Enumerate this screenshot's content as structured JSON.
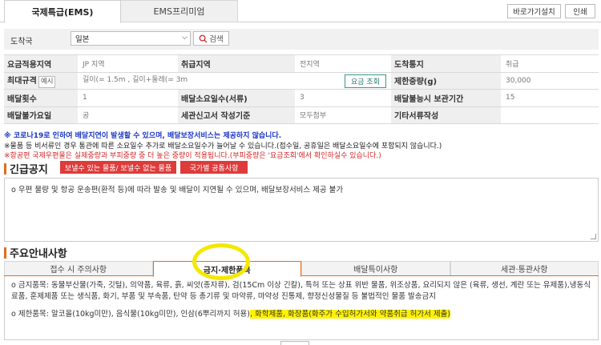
{
  "top_tabs": [
    {
      "label": "국제특급(EMS)",
      "active": true
    },
    {
      "label": "EMS프리미엄",
      "active": false
    }
  ],
  "top_buttons": {
    "shortcut": "바로가기설치",
    "print": "인쇄"
  },
  "destination": {
    "label": "도착국",
    "selected": "일본",
    "search_label": "검색"
  },
  "info_table": {
    "rows": [
      [
        {
          "label": "요금적용지역",
          "value": "JP 지역"
        },
        {
          "label": "취급지역",
          "value": "전지역"
        },
        {
          "label": "도착통지",
          "value": "취급"
        }
      ],
      [
        {
          "label": "최대규격",
          "value": "길이(= 1.5m , 길이+둘레(= 3m"
        },
        {
          "label": "제한중량(g)",
          "value": "30,000"
        }
      ],
      [
        {
          "label": "배달횟수",
          "value": "1"
        },
        {
          "label": "배달소요일수(서류)",
          "value": "3"
        },
        {
          "label": "배달불능시 보관기간",
          "value": "15"
        }
      ],
      [
        {
          "label": "배달불가요일",
          "value": "공"
        },
        {
          "label": "세관신고서 작성기준",
          "value": "모두첨부"
        },
        {
          "label": "기타서류작성",
          "value": ""
        }
      ]
    ],
    "example_btn": "예시",
    "rate_btn": "요금 조회"
  },
  "notices": [
    "※ 코로나19로 인하여 배달지연이 발생할 수 있으며, 배달보장서비스는 제공하지 않습니다.",
    "※물품 등 비서류인 경우 통관에 따른 소요일수 추가로 배달소요일수가 늘어날 수 있습니다.(접수일, 공휴일은 배달소요일수에 포함되지 않습니다.)",
    "※항공편 국제우편물은 실제중량과 부피중량 중 더 높은 중량이 적용됩니다.(부피중량은 '요금조회'에서 확인하실수 있습니다.)"
  ],
  "urgent": {
    "title": "긴급공지",
    "buttons": [
      "보낼수 있는 물품/ 보낼수 없는 물품",
      "국가별 공통사항"
    ],
    "content": "o 우편 물량 및 항공 운송편(환적 등)에 따라 발송 및 배달이 지연될 수 있으며, 배달보장서비스 제공 불가"
  },
  "main_info": {
    "title": "주요안내사항",
    "tabs": [
      {
        "label": "접수 시 주의사항",
        "active": false
      },
      {
        "label": "금지·제한품목",
        "active": true
      },
      {
        "label": "배달특이사항",
        "active": false
      },
      {
        "label": "세관·통관사항",
        "active": false
      }
    ],
    "prohibited": "o 금지품목: 동물부산물(가죽, 깃털), 의약품, 육류, 흙, 씨앗(종자류), 검(15Cm 이상 긴칼), 특허 또는 상표 위반 물품, 위조상품, 요리되지 않은 (육류, 생선, 계란 또는 유제품),냉동식료품, 훈제제품 또는 생식품, 화기, 부품 및 부속품, 탄약 등 총기류 및 마약류, 마약성 진통제, 향정신성물질 등 불법적인 물품 발송금지",
    "restricted_prefix": "o 제한품목: 알코올(10kg미만), 음식물(10kg미만), 인삼(6뿌리까지 허용)",
    "restricted_highlight": ", 화학제품, 화장품(화주가 수입허가서와 약품취급 허가서 제출)"
  },
  "colors": {
    "accent": "#e36c1e",
    "red_btn": "#de3b3b",
    "notice_blue": "#1a35c8",
    "notice_red": "#d42626",
    "highlight": "#fff200"
  }
}
